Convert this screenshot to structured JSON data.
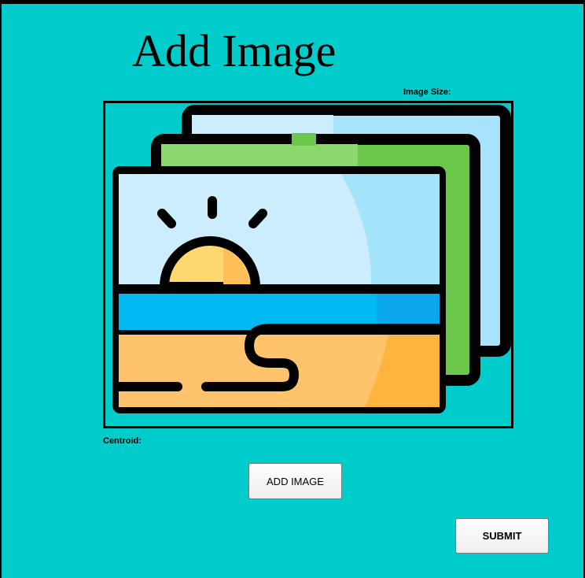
{
  "title": "Add Image",
  "image_size_label": "Image Size:",
  "centroid_label": "Centroid:",
  "buttons": {
    "add_image": "ADD IMAGE",
    "submit": "SUBMIT"
  },
  "colors": {
    "background": "#00CCCC",
    "sky": "#CBEDFD",
    "sea": "#00B9F3",
    "sand": "#FFC36B",
    "green_card": "#6CC84B",
    "sun": "#FFD86F"
  },
  "preview_image": "gallery-placeholder-icon"
}
